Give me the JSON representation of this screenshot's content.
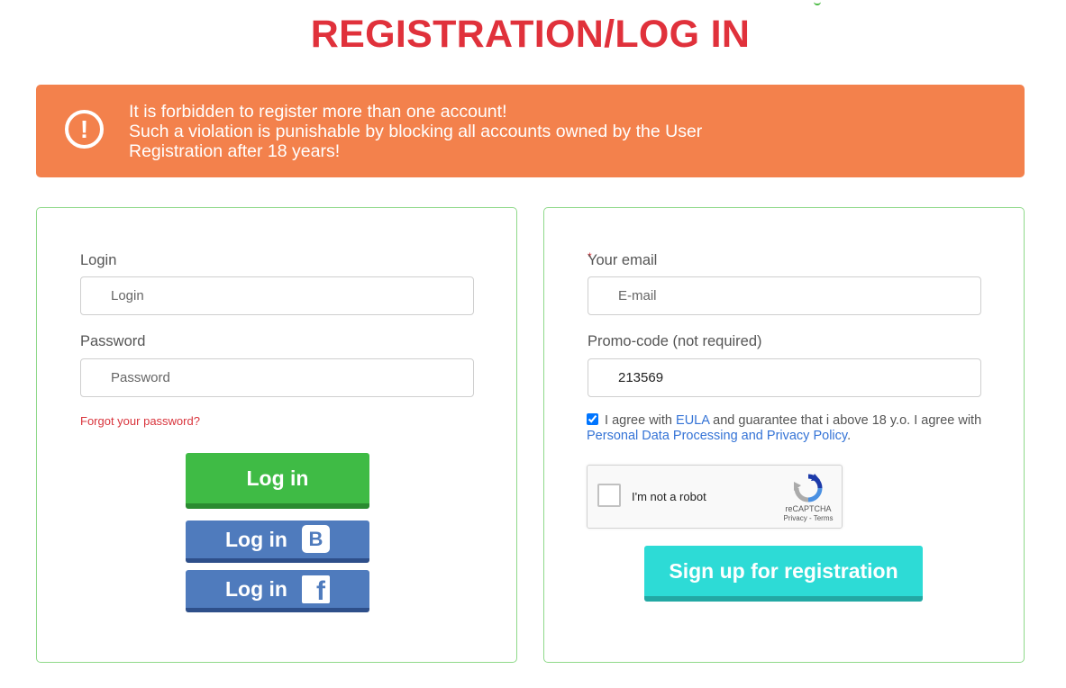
{
  "page": {
    "title": "REGISTRATION/LOG IN"
  },
  "warning": {
    "icon": "exclamation-circle-icon",
    "icon_glyph": "!",
    "line1": "It is forbidden to register more than one account!",
    "line2": "Such a violation is punishable by blocking all accounts owned by the User",
    "line3": "Registration after 18 years!",
    "background_color": "#f3814c"
  },
  "login_form": {
    "login_label": "Login",
    "login_placeholder": "Login",
    "password_label": "Password",
    "password_placeholder": "Password",
    "forgot_link": "Forgot your password?",
    "login_button": "Log in",
    "vk_button": "Log in",
    "vk_icon": "vk-icon",
    "vk_glyph": "B",
    "fb_button": "Log in",
    "fb_icon": "facebook-icon",
    "fb_glyph": "f"
  },
  "register_form": {
    "required_mark": "*",
    "email_label": "Your email",
    "email_placeholder": "E-mail",
    "promo_label": "Promo-code (not required)",
    "promo_value": "213569",
    "agree_text_1": "I agree with",
    "eula_link": "EULA",
    "agree_text_2": "and guarantee that i above 18 y.o. I agree with",
    "privacy_link": "Personal Data Processing and Privacy Policy",
    "agree_text_3": ".",
    "agree_checked": true,
    "captcha_label": "I'm not a robot",
    "captcha_brand": "reCAPTCHA",
    "captcha_terms": "Privacy - Terms",
    "signup_button": "Sign up for registration"
  },
  "colors": {
    "title": "#e0313b",
    "login_button": "#3fbb45",
    "social_button": "#4f7bbd",
    "signup_button": "#2ddbd6",
    "panel_border": "#8fd98a",
    "link": "#3473d6"
  }
}
